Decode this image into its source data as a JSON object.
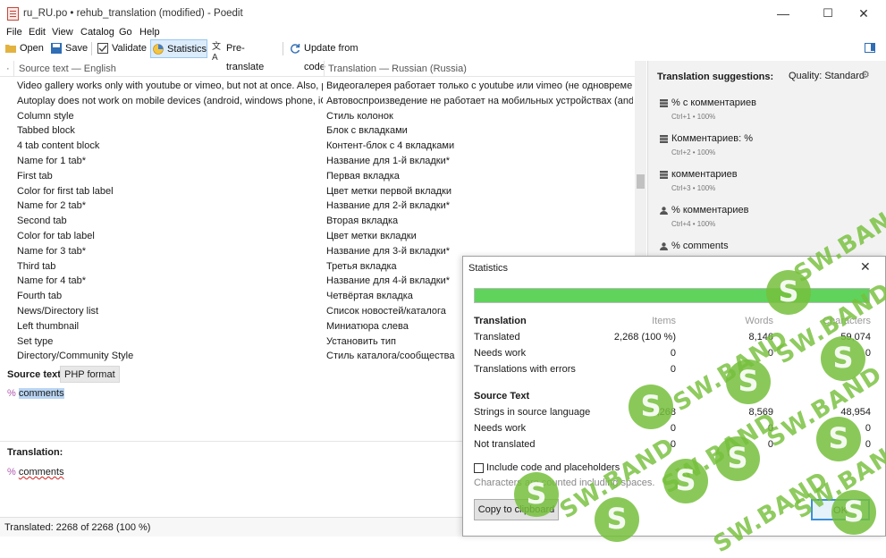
{
  "window": {
    "title": "ru_RU.po • rehub_translation (modified) - Poedit",
    "minimize": "—",
    "maximize": "☐",
    "close": "✕"
  },
  "menu": [
    "File",
    "Edit",
    "View",
    "Catalog",
    "Go",
    "Help"
  ],
  "toolbar": {
    "open": "Open",
    "save": "Save",
    "validate": "Validate",
    "statistics": "Statistics",
    "pretranslate": "Pre-translate",
    "update": "Update from code"
  },
  "list": {
    "col_dot": "·",
    "col_source": "Source text — English",
    "col_translation": "Translation — Russian (Russia)",
    "rows": [
      {
        "src": "Video gallery works only with youtube or vimeo, but not at once. Also, playli...",
        "trn": "Видеогалерея работает только с youtube или vimeo (не одновременно)..."
      },
      {
        "src": "Autoplay does not work on mobile devices (android, windows phone, iOS)",
        "trn": "Автовоспроизведение не работает на мобильных устройствах (android,..."
      },
      {
        "src": "Column style",
        "trn": "Стиль колонок"
      },
      {
        "src": "Tabbed block",
        "trn": "Блок с вкладками"
      },
      {
        "src": "4 tab content block",
        "trn": "Контент-блок с 4 вкладками"
      },
      {
        "src": "Name for 1 tab*",
        "trn": "Название для 1-й вкладки*"
      },
      {
        "src": "First tab",
        "trn": "Первая вкладка"
      },
      {
        "src": "Color for first tab label",
        "trn": "Цвет метки первой вкладки"
      },
      {
        "src": "Name for 2 tab*",
        "trn": "Название для 2-й вкладки*"
      },
      {
        "src": "Second tab",
        "trn": "Вторая вкладка"
      },
      {
        "src": "Color for tab label",
        "trn": "Цвет метки вкладки"
      },
      {
        "src": "Name for 3 tab*",
        "trn": "Название для 3-й вкладки*"
      },
      {
        "src": "Third tab",
        "trn": "Третья вкладка"
      },
      {
        "src": "Name for 4 tab*",
        "trn": "Название для 4-й вкладки*"
      },
      {
        "src": "Fourth tab",
        "trn": "Четвёртая вкладка"
      },
      {
        "src": "News/Directory list",
        "trn": "Список новостей/каталога"
      },
      {
        "src": "Left thumbnail",
        "trn": "Миниатюра слева"
      },
      {
        "src": "Set type",
        "trn": "Установить тип"
      },
      {
        "src": "Directory/Community Style",
        "trn": "Стиль каталога/сообщества"
      }
    ]
  },
  "source_panel": {
    "label": "Source text:",
    "badge": "PHP format",
    "pct": "%",
    "word": "comments"
  },
  "translation_panel": {
    "label": "Translation:",
    "pct": "%",
    "word": "comments"
  },
  "status": "Translated: 2268 of 2268 (100 %)",
  "suggestions": {
    "title": "Translation suggestions:",
    "quality": "Quality: Standard",
    "items": [
      {
        "text": "% с комментариев",
        "meta": "Ctrl+1 • 100%",
        "icon": "database-icon"
      },
      {
        "text": "Комментариев: %",
        "meta": "Ctrl+2 • 100%",
        "icon": "database-icon"
      },
      {
        "text": "комментариев",
        "meta": "Ctrl+3 • 100%",
        "icon": "database-icon"
      },
      {
        "text": "% комментариев",
        "meta": "Ctrl+4 • 100%",
        "icon": "user-icon"
      },
      {
        "text": "% comments",
        "meta": "",
        "icon": "user-icon"
      }
    ]
  },
  "statistics": {
    "title": "Statistics",
    "progress": 1.0,
    "headers": {
      "items": "Items",
      "words": "Words",
      "characters": "Characters"
    },
    "translation_section": "Translation",
    "translation_rows": [
      {
        "label": "Translated",
        "items": "2,268 (100 %)",
        "words": "8,146",
        "chars": "59,074"
      },
      {
        "label": "Needs work",
        "items": "0",
        "words": "0",
        "chars": "0"
      },
      {
        "label": "Translations with errors",
        "items": "0",
        "words": "",
        "chars": ""
      }
    ],
    "source_section": "Source Text",
    "source_rows": [
      {
        "label": "Strings in source language",
        "items": "2,268",
        "words": "8,569",
        "chars": "48,954"
      },
      {
        "label": "Needs work",
        "items": "0",
        "words": "0",
        "chars": "0"
      },
      {
        "label": "Not translated",
        "items": "0",
        "words": "0",
        "chars": "0"
      }
    ],
    "checkbox": "Include code and placeholders",
    "hint": "Characters are counted including spaces.",
    "copy": "Copy to clipboard",
    "ok": "OK"
  },
  "watermark": {
    "text": "SW.BAND",
    "color": "#76c03c"
  }
}
